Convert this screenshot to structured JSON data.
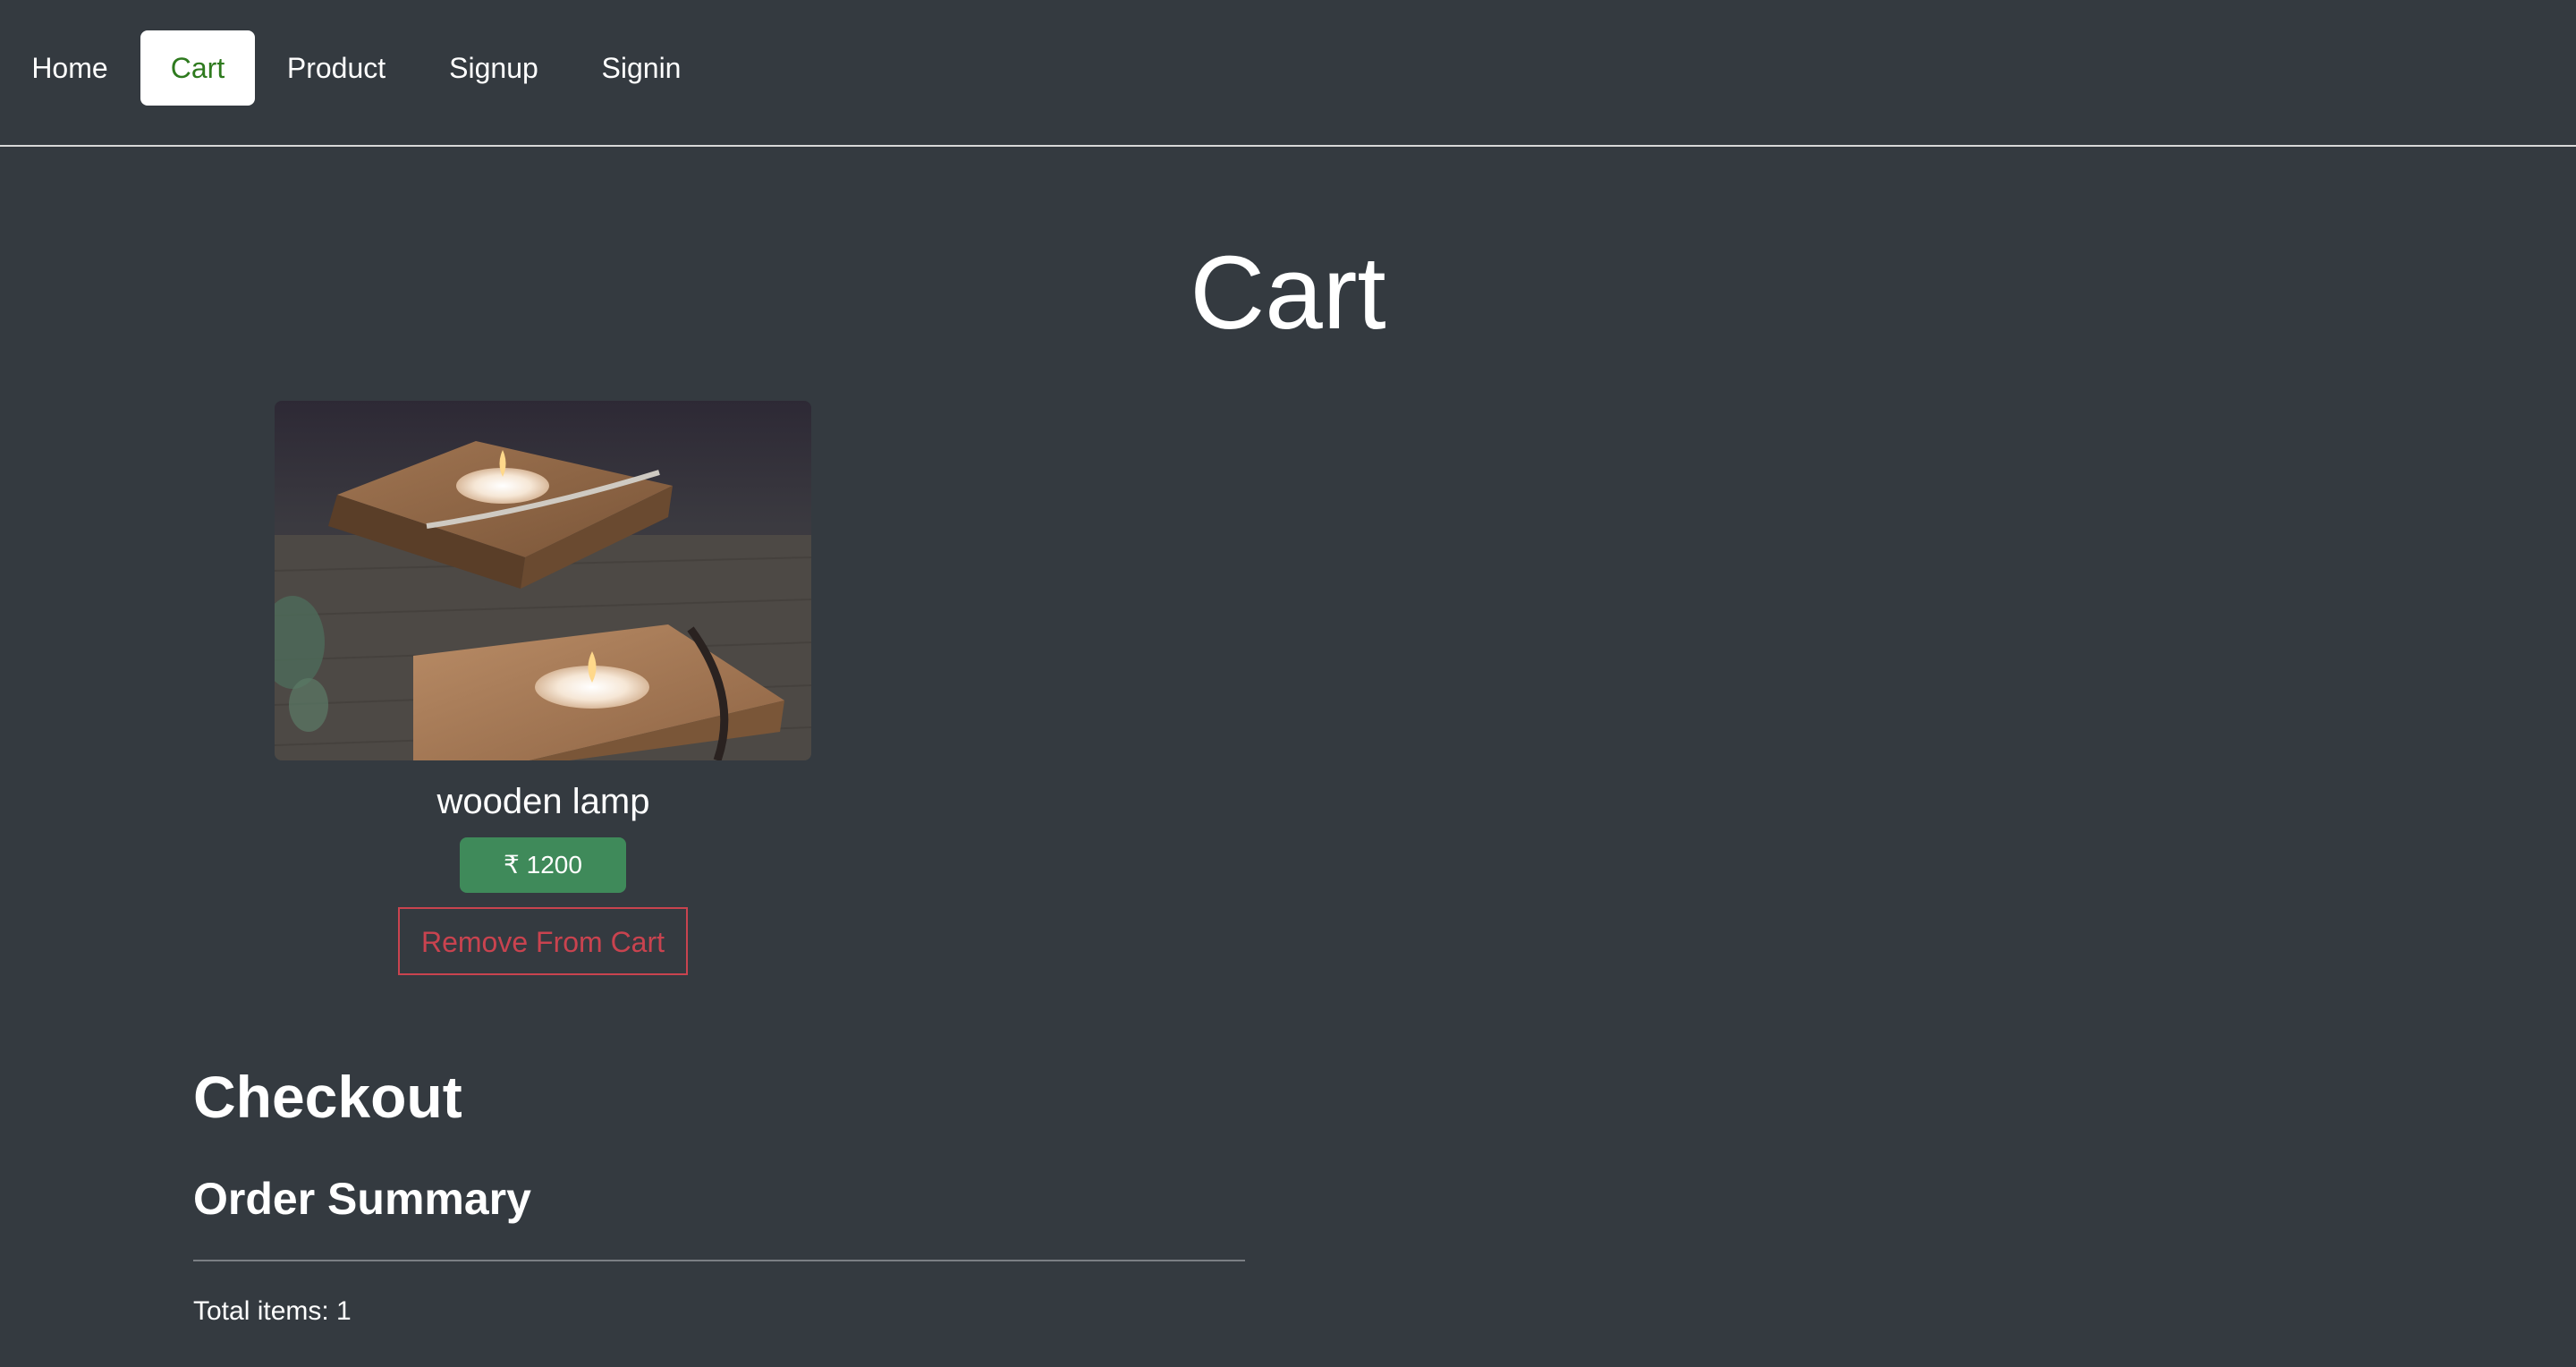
{
  "nav": {
    "items": [
      {
        "label": "Home",
        "active": false
      },
      {
        "label": "Cart",
        "active": true
      },
      {
        "label": "Product",
        "active": false
      },
      {
        "label": "Signup",
        "active": false
      },
      {
        "label": "Signin",
        "active": false
      }
    ],
    "active_color": "#2e7a1e"
  },
  "page": {
    "title": "Cart"
  },
  "cart": {
    "items": [
      {
        "name": "wooden lamp",
        "price": "₹ 1200",
        "remove_label": "Remove From Cart",
        "image_icon": "candle-holder-photo"
      }
    ]
  },
  "checkout": {
    "title": "Checkout",
    "summary_title": "Order Summary",
    "total_items": "Total items: 1"
  },
  "colors": {
    "background": "#343a40",
    "price_badge": "#3f8a5a",
    "remove_button": "#c9434f"
  }
}
